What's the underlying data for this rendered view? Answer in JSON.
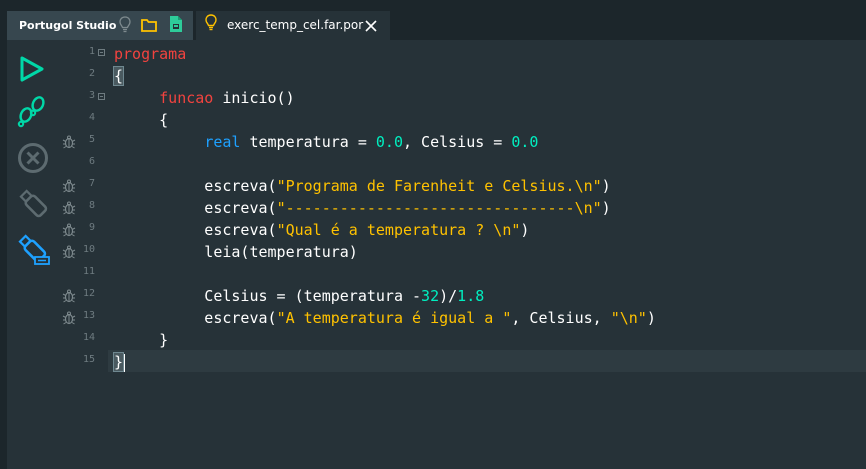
{
  "app": {
    "title": "Portugol Studio"
  },
  "file_tab": {
    "name": "exerc_temp_cel.far.por"
  },
  "toolbar": {
    "run": "play-icon",
    "step": "footsteps-icon",
    "stop": "stop-icon",
    "usb": "usb-icon",
    "usb_device": "usb-device-icon"
  },
  "gutter": {
    "line_numbers": [
      "1",
      "2",
      "3",
      "4",
      "5",
      "6",
      "7",
      "8",
      "9",
      "10",
      "11",
      "12",
      "13",
      "14",
      "15"
    ]
  },
  "code": {
    "l1_kw": "programa",
    "l2": "{",
    "l3_indent": "     ",
    "l3_kw": "funcao",
    "l3_rest": " inicio()",
    "l4": "     {",
    "l5_indent": "          ",
    "l5_type": "real",
    "l5_a": " temperatura = ",
    "l5_n1": "0.0",
    "l5_b": ", Celsius = ",
    "l5_n2": "0.0",
    "l7_a": "          escreva(",
    "l7_s": "\"Programa de Farenheit e Celsius.\\n\"",
    "l7_b": ")",
    "l8_a": "          escreva(",
    "l8_s": "\"--------------------------------\\n\"",
    "l8_b": ")",
    "l9_a": "          escreva(",
    "l9_s": "\"Qual é a temperatura ? \\n\"",
    "l9_b": ")",
    "l10": "          leia(temperatura)",
    "l12_a": "          Celsius = (temperatura -",
    "l12_n1": "32",
    "l12_b": ")/",
    "l12_n2": "1.8",
    "l13_a": "          escreva(",
    "l13_s1": "\"A temperatura é igual a \"",
    "l13_b": ", Celsius, ",
    "l13_s2": "\"\\n\"",
    "l13_c": ")",
    "l14": "     }",
    "l15": "}"
  },
  "colors": {
    "background": "#263238",
    "keyword": "#f1433f",
    "type": "#1ea1ff",
    "string": "#ffc200",
    "number": "#00efc0",
    "text": "#ffffff"
  }
}
